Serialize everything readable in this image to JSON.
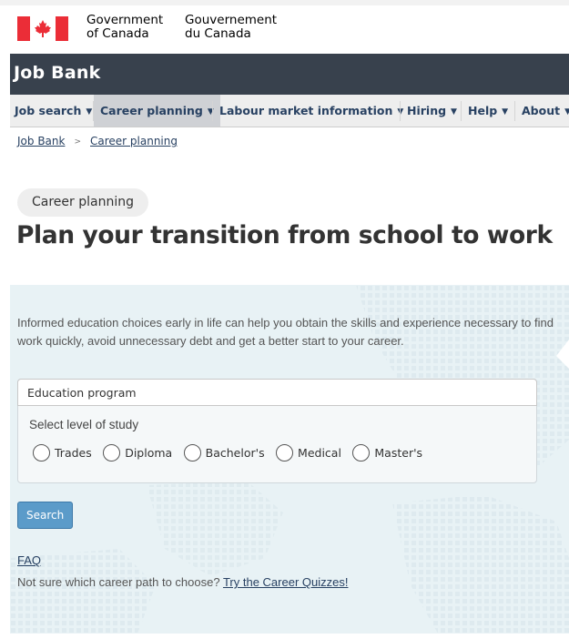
{
  "gov": {
    "english_line1": "Government",
    "english_line2": "of Canada",
    "french_line1": "Gouvernement",
    "french_line2": "du Canada"
  },
  "banner": {
    "title": "Job Bank"
  },
  "menu": {
    "items": [
      {
        "label": "Job search"
      },
      {
        "label": "Career planning"
      },
      {
        "label": "Labour market information"
      },
      {
        "label": "Hiring"
      },
      {
        "label": "Help"
      },
      {
        "label": "About"
      }
    ],
    "active_index": 1
  },
  "breadcrumb": {
    "items": [
      "Job Bank",
      "Career planning"
    ],
    "separator": ">"
  },
  "page": {
    "pill": "Career planning",
    "title": "Plan your transition from school to work"
  },
  "panel": {
    "intro": "Informed education choices early in life can help you obtain the skills and experience necessary to find work quickly, avoid unnecessary debt and get a better start to your career.",
    "program_placeholder": "Education program",
    "level_label": "Select level of study",
    "levels": [
      "Trades",
      "Diploma",
      "Bachelor's",
      "Medical",
      "Master's"
    ],
    "search_label": "Search",
    "faq_label": "FAQ",
    "quiz_prompt": "Not sure which career path to choose? ",
    "quiz_link": "Try the Career Quizzes!"
  },
  "colors": {
    "banner_bg": "#38414d",
    "menu_bg": "#eeeeee",
    "menu_active_bg": "#cfd1d5",
    "link": "#284162",
    "panel_bg": "#e8f2f5",
    "search_button": "#5b9bc9",
    "flag_red": "#eb2d37"
  },
  "icons": {
    "flag": "canada-flag-icon",
    "menu_chevron": "chevron-down-icon",
    "radio": "radio-button-icon"
  }
}
